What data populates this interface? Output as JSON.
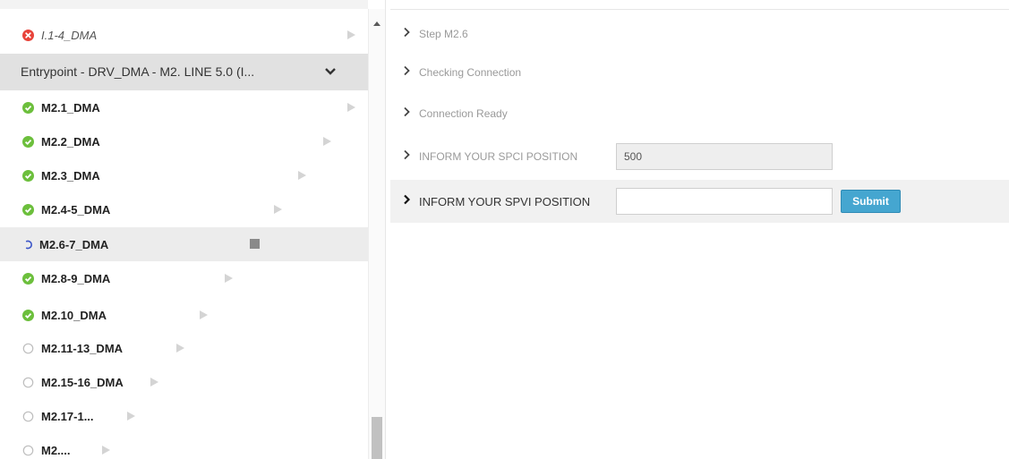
{
  "sidebar": {
    "first_item": {
      "label": "I.1-4_DMA",
      "status": "error"
    },
    "group": {
      "title": "Entrypoint - DRV_DMA - M2. LINE 5.0 (I..."
    },
    "items": [
      {
        "label": "M2.1_DMA",
        "status": "done",
        "action": "play"
      },
      {
        "label": "M2.2_DMA",
        "status": "done",
        "action": "play"
      },
      {
        "label": "M2.3_DMA",
        "status": "done",
        "action": "play"
      },
      {
        "label": "M2.4-5_DMA",
        "status": "done",
        "action": "play"
      },
      {
        "label": "M2.6-7_DMA",
        "status": "running",
        "action": "stop"
      },
      {
        "label": "M2.8-9_DMA",
        "status": "done",
        "action": "play"
      },
      {
        "label": "M2.10_DMA",
        "status": "done",
        "action": "play"
      },
      {
        "label": "M2.11-13_DMA",
        "status": "pending",
        "action": "play"
      },
      {
        "label": "M2.15-16_DMA",
        "status": "pending",
        "action": "play"
      },
      {
        "label": "M2.17-1...",
        "status": "pending",
        "action": "play"
      },
      {
        "label": "M2....",
        "status": "pending",
        "action": "play"
      }
    ]
  },
  "steps": [
    {
      "label": "Step M2.6"
    },
    {
      "label": "Checking Connection"
    },
    {
      "label": "Connection Ready"
    },
    {
      "label": "INFORM YOUR SPCI POSITION",
      "value": "500"
    },
    {
      "label": "INFORM YOUR SPVI POSITION",
      "value": ""
    }
  ],
  "submit_label": "Submit",
  "icons": {
    "error": "x-circle-icon",
    "done": "check-circle-icon",
    "running": "spinner-icon",
    "pending": "empty-circle-icon",
    "play": "play-icon",
    "stop": "stop-icon",
    "expand": "chevron-down-icon",
    "step": "chevron-right-icon"
  },
  "colors": {
    "error": "#e8433a",
    "done": "#6cbf3c",
    "running": "#3b55c8",
    "pending": "#bdbdbd",
    "submit": "#45a6d0"
  }
}
